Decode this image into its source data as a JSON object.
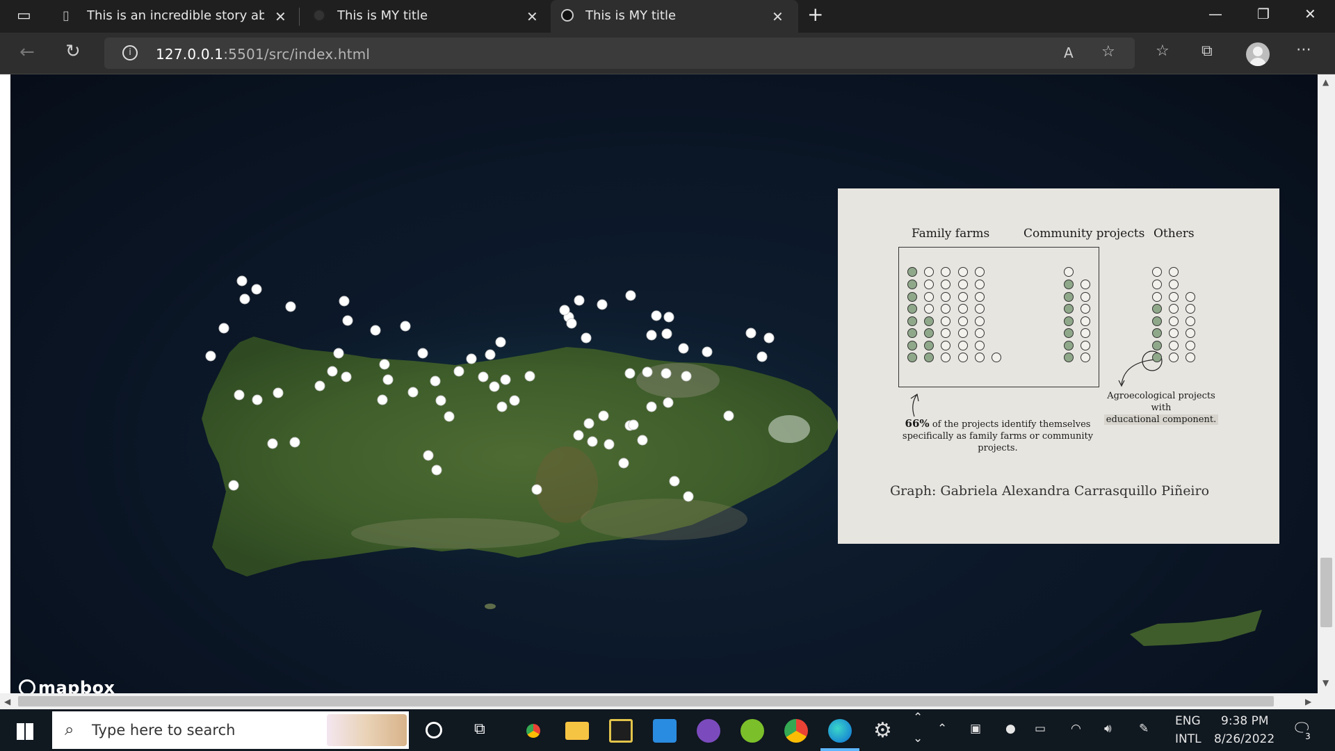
{
  "browser": {
    "tabs": [
      {
        "label": "This is an incredible story about i",
        "active": false
      },
      {
        "label": "This is MY title",
        "active": false
      },
      {
        "label": "This is MY title",
        "active": true
      }
    ],
    "new_tab_icon": "plus-icon",
    "url_host": "127.0.0.1",
    "url_path": ":5501/src/index.html"
  },
  "map": {
    "attribution": "mapbox",
    "marker_color": "#ffffff"
  },
  "panel": {
    "headings": {
      "family": "Family farms",
      "community": "Community projects",
      "others": "Others"
    },
    "note_left_bold": "66%",
    "note_left_line1": "of the projects identify themselves",
    "note_left_line2": "specifically as family farms or community projects.",
    "note_right_line1": "Agroecological projects with",
    "note_right_line2": "educational component.",
    "credit": "Graph: Gabriela Alexandra Carrasquillo Piñeiro",
    "filled_color": "#8fa88a",
    "empty_color": "#f2f1ec"
  },
  "taskbar": {
    "search_placeholder": "Type here to search",
    "lang_line1": "ENG",
    "lang_line2": "INTL",
    "time": "9:38 PM",
    "date": "8/26/2022",
    "notification_count": "3"
  }
}
